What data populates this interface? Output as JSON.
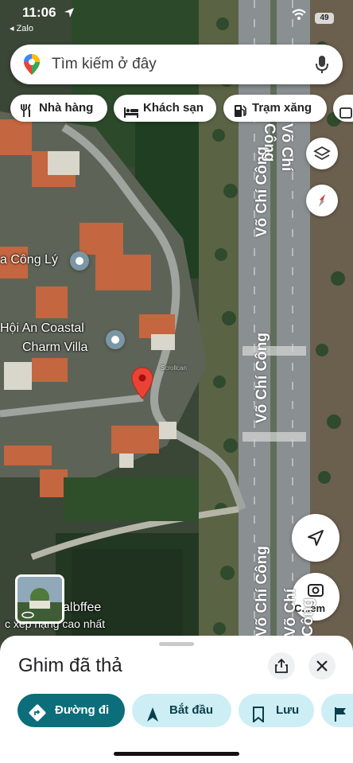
{
  "status_bar": {
    "time": "11:06",
    "back_app": "◂ Zalo",
    "battery": "49"
  },
  "search": {
    "placeholder": "Tìm kiếm ở đây"
  },
  "chips": [
    {
      "label": "Nhà hàng",
      "icon": "fork-knife-icon"
    },
    {
      "label": "Khách sạn",
      "icon": "bed-icon"
    },
    {
      "label": "Trạm xăng",
      "icon": "gas-pump-icon"
    }
  ],
  "map": {
    "places": [
      {
        "name": "a Công Lý"
      },
      {
        "name": "Hội An Coastal",
        "name2": "Charm Villa"
      },
      {
        "name": "all",
        "name_suffix": "offee"
      },
      {
        "name": "c xếp hạng cao nhất"
      }
    ],
    "roads": [
      "Võ Chí Công",
      "Võ Chí Công",
      "Võ Chí Công",
      "Võ Chí Công",
      "Võ Chí Công"
    ],
    "watermark": "Scrollcan",
    "streetview_label": "C...em"
  },
  "sheet": {
    "title": "Ghim đã thả",
    "actions": [
      {
        "label": "Đường đi",
        "icon": "directions-icon",
        "primary": true
      },
      {
        "label": "Bắt đầu",
        "icon": "navigation-arrow-icon"
      },
      {
        "label": "Lưu",
        "icon": "bookmark-icon"
      }
    ]
  },
  "colors": {
    "accent": "#0b6e7a",
    "chip_blue": "#cdeef5",
    "pin_red": "#ea4335"
  }
}
